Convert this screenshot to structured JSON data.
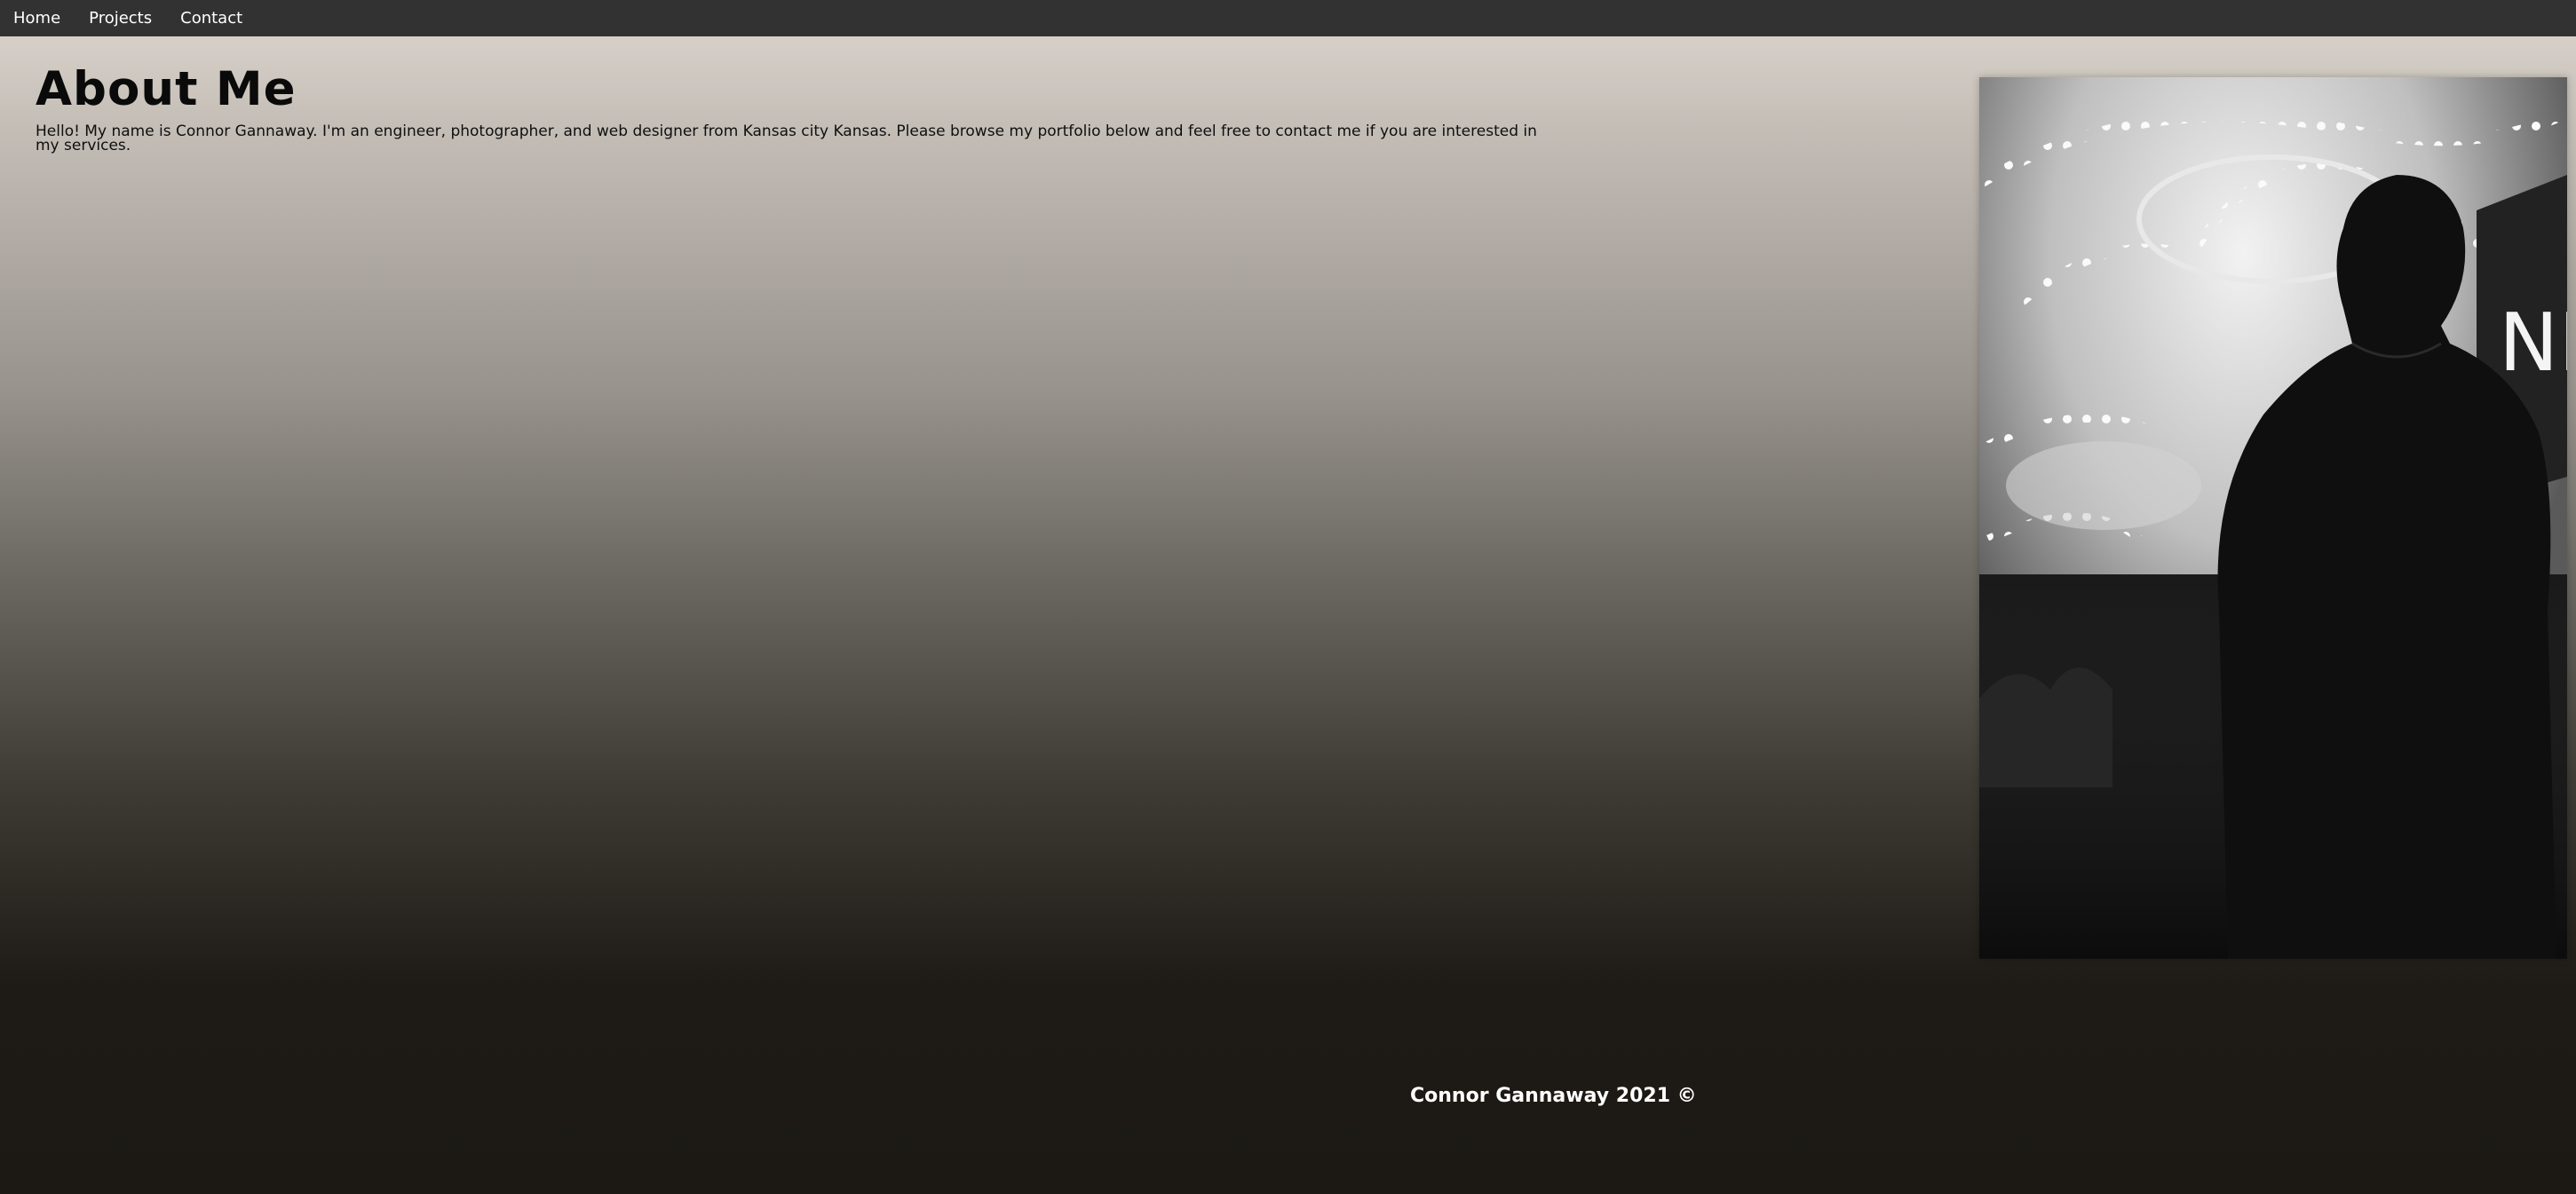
{
  "nav": {
    "items": [
      {
        "label": "Home"
      },
      {
        "label": "Projects"
      },
      {
        "label": "Contact"
      }
    ]
  },
  "about": {
    "title": "About Me",
    "intro": "Hello! My name is Connor Gannaway. I'm an engineer, photographer, and web designer from Kansas city Kansas. Please browse my portfolio below and feel free to contact me if you are interested in my services."
  },
  "portrait": {
    "sign_text": "ND"
  },
  "footer": {
    "copyright": "Connor Gannaway 2021 ©"
  }
}
